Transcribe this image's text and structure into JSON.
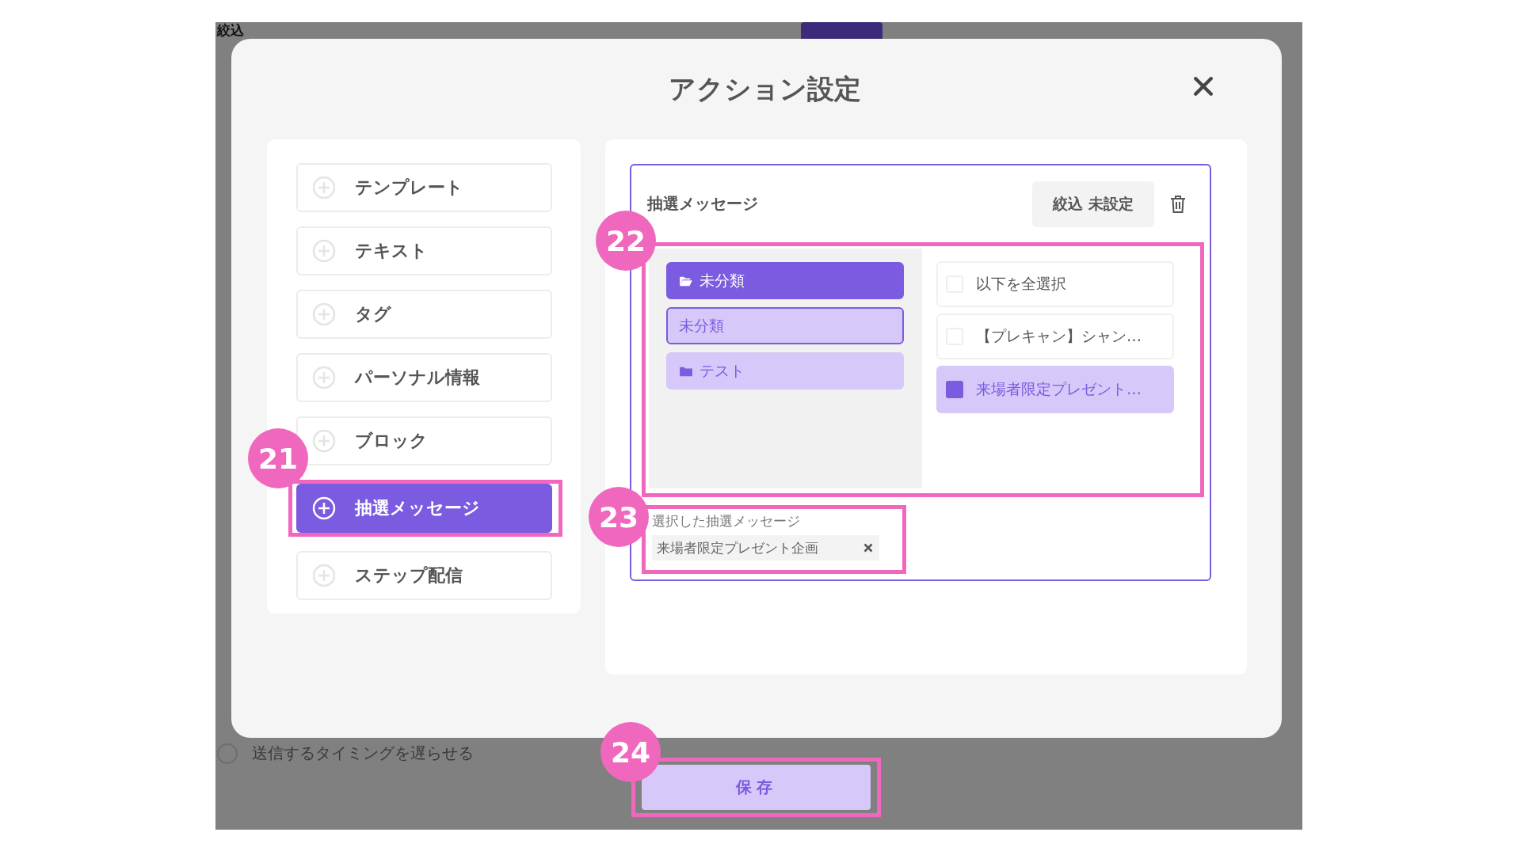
{
  "background": {
    "heading": "絞込",
    "delay_option": {
      "label": "送信するタイミングを遅らせる",
      "checked": false
    }
  },
  "modal": {
    "title": "アクション設定"
  },
  "action_types": [
    {
      "label": "テンプレート",
      "selected": false
    },
    {
      "label": "テキスト",
      "selected": false
    },
    {
      "label": "タグ",
      "selected": false
    },
    {
      "label": "パーソナル情報",
      "selected": false
    },
    {
      "label": "ブロック",
      "selected": false
    },
    {
      "label": "抽選メッセージ",
      "selected": true,
      "annotation": "21"
    },
    {
      "label": "ステップ配信",
      "selected": false
    }
  ],
  "editor": {
    "title": "抽選メッセージ",
    "filter_button": "絞込 未設定",
    "picker": {
      "annotation": "22",
      "folders": [
        {
          "label": "未分類",
          "expanded": true,
          "children": [
            {
              "label": "未分類",
              "selected": true
            }
          ]
        },
        {
          "label": "テスト",
          "expanded": false
        }
      ],
      "messages": [
        {
          "label": "以下を全選択",
          "checked": false
        },
        {
          "label": "【プレキャン】シャン…",
          "checked": false
        },
        {
          "label": "来場者限定プレゼント…",
          "checked": true
        }
      ]
    },
    "selected": {
      "annotation": "23",
      "label": "選択した抽選メッセージ",
      "chips": [
        {
          "label": "来場者限定プレゼント企画"
        }
      ]
    }
  },
  "save": {
    "label": "保存",
    "annotation": "24"
  }
}
